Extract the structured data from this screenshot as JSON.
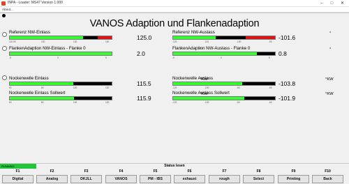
{
  "window": {
    "title": "INPA - Loader: MS47 Version 1.000",
    "minimize": "–",
    "maximize": "□",
    "close": "✕"
  },
  "menu": {
    "about": "About..."
  },
  "page": {
    "title": "VANOS Adaption und Flankenadaption"
  },
  "gauges": [
    {
      "label": "Referenz NW-Einlass",
      "value": "125.0",
      "unit": "°",
      "fill": 0.72,
      "red_start": 0.86,
      "ticks": [
        "110.00",
        "120",
        "130",
        "140"
      ]
    },
    {
      "label": "FlankenAdaption NW-Einlass - Flanke 0",
      "value": "2.0",
      "unit": "°",
      "fill": 1.0,
      "red_start": null,
      "ticks": [
        "-5",
        "0",
        "5"
      ]
    },
    {
      "label": "Referenz NW-Auslass",
      "value": "-101.6",
      "unit": "°",
      "fill": 0.42,
      "red_start": 0.71,
      "ticks": [
        "-120",
        "-110",
        "-100",
        "-90"
      ]
    },
    {
      "label": "FlankenAdaption NW-Auslass - Flanke 0",
      "value": "0.8",
      "unit": "°",
      "fill": 0.82,
      "red_start": null,
      "ticks": [
        "-5",
        "0",
        "5"
      ]
    },
    {
      "label": "Nockenwelle Einlass",
      "value": "115.5",
      "unit": "°KW",
      "fill": 0.62,
      "red_start": null,
      "ticks": [
        "60",
        "80",
        "100",
        "120"
      ]
    },
    {
      "label": "Nockenwelle Einlass Sollwert",
      "value": "115.9",
      "unit": "°KW",
      "fill": 0.63,
      "red_start": null,
      "ticks": [
        "60",
        "80",
        "100",
        "120"
      ]
    },
    {
      "label": "Nockenwelle Auslass",
      "value": "-103.8",
      "unit": "°KW",
      "fill": 0.68,
      "red_start": null,
      "ticks": [
        "-120",
        "-100",
        "-80",
        "-60"
      ]
    },
    {
      "label": "Nockenwelle Auslass Sollwert",
      "value": "-101.9",
      "unit": "°KW",
      "fill": 0.7,
      "red_start": null,
      "ticks": [
        "-120",
        "-100",
        "-80",
        "-60"
      ]
    }
  ],
  "status": {
    "running": "RUNNING",
    "center": "Status lesen"
  },
  "fkeys": [
    {
      "key": "F1",
      "label": "Digital"
    },
    {
      "key": "F2",
      "label": "Analog"
    },
    {
      "key": "F3",
      "label": "DKJLL"
    },
    {
      "key": "F4",
      "label": "VANOS"
    },
    {
      "key": "F5",
      "label": "PM - IBS"
    },
    {
      "key": "F6",
      "label": "exhaust"
    },
    {
      "key": "F7",
      "label": "rough"
    },
    {
      "key": "F8",
      "label": "Select"
    },
    {
      "key": "F9",
      "label": "Printing"
    },
    {
      "key": "F10",
      "label": "Back"
    }
  ],
  "colors": {
    "green": "#33ff33",
    "red": "#d91515",
    "running": "#22c43a"
  }
}
